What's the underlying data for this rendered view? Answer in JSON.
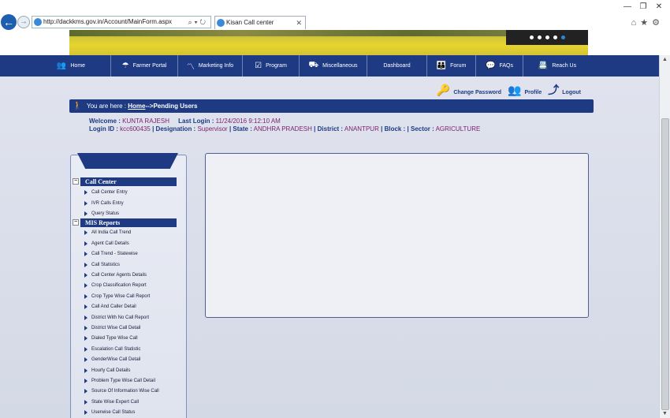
{
  "browser": {
    "url": "http://dackkms.gov.in/Account/MainForm.aspx",
    "tab_title": "Kisan Call center"
  },
  "nav": [
    {
      "label": "Home",
      "icon": "people-icon"
    },
    {
      "label": "Farmer Portal",
      "icon": "umbrella-icon"
    },
    {
      "label": "Marketing Info",
      "icon": "chart-icon"
    },
    {
      "label": "Program",
      "icon": "checkbox-icon"
    },
    {
      "label": "Miscellaneous",
      "icon": "tractor-icon"
    },
    {
      "label": "Dashboard",
      "icon": ""
    },
    {
      "label": "Forum",
      "icon": "group-icon"
    },
    {
      "label": "FAQs",
      "icon": "chat-icon"
    },
    {
      "label": "Reach Us",
      "icon": "contact-icon"
    }
  ],
  "user_links": {
    "change_password": "Change Password",
    "profile": "Profile",
    "logout": "Logout"
  },
  "breadcrumb": {
    "prefix": "You are here :",
    "home": "Home",
    "current": "-->Pending Users"
  },
  "welcome": {
    "welcome_label": "Welcome :",
    "user_name": "KUNTA RAJESH",
    "last_login_label": "Last Login :",
    "last_login": "11/24/2016 9:12:10 AM",
    "login_id_label": "Login ID :",
    "login_id": "kcc600435",
    "designation_label": "Designation :",
    "designation": "Supervisor",
    "state_label": "State :",
    "state": "ANDHRA PRADESH",
    "district_label": "District :",
    "district": "ANANTPUR",
    "block_label": "Block :",
    "sector_label": "Sector :",
    "sector": "AGRICULTURE",
    "sep": "|"
  },
  "sidebar": {
    "sections": [
      {
        "title": "Call Center",
        "toggle": "−",
        "items": [
          "Call Center Entry",
          "IVR Calls Entry",
          "Query Status"
        ]
      },
      {
        "title": "MIS Reports",
        "toggle": "−",
        "items": [
          "All India Call Trend",
          "Agent Call Details",
          "Call Trend - Statewise",
          "Call Statistics",
          "Call Center Agents Details",
          "Crop Classification Report",
          "Crop Type Wise Call Report",
          "Call And Caller Detail",
          "District With No Call Report",
          "District Wise Call Detail",
          "Dialed Type Wise Call",
          "Escalation Call Statistic",
          "GenderWise Call Detail",
          "Hourly Call Details",
          "Problem Type Wise Call Detail",
          "Source Of Information Wise Call",
          "State Wise Expert Call",
          "Userwise Call Status"
        ]
      }
    ]
  }
}
